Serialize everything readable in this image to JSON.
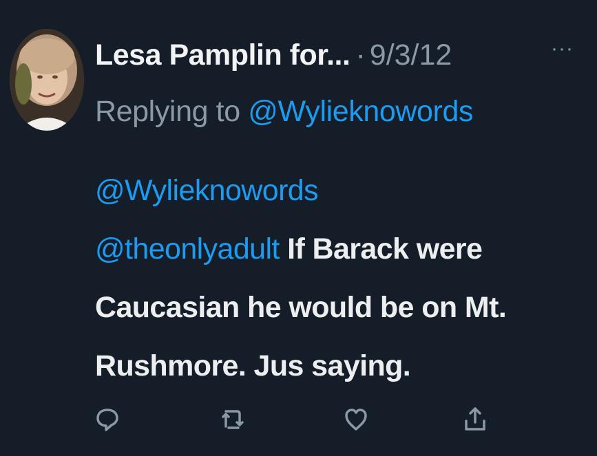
{
  "tweet": {
    "author_name": "Lesa Pamplin for...",
    "separator": "·",
    "date": "9/3/12",
    "more_label": "···",
    "reply_prefix": "Replying to",
    "reply_to": "@Wylieknowords",
    "body": {
      "mention_1": "@Wylieknowords",
      "mention_2": "@theonlyadult",
      "text_line_1": " If Barack were",
      "text_line_2": "Caucasian he would be on Mt.",
      "text_line_3": "Rushmore.  Jus saying."
    }
  },
  "actions": {
    "reply_icon": "comment-icon",
    "retweet_icon": "retweet-icon",
    "like_icon": "heart-icon",
    "share_icon": "share-icon"
  },
  "colors": {
    "background": "#141d28",
    "text": "#e7e9ea",
    "muted": "#8b98a5",
    "link": "#1d9bf0"
  }
}
